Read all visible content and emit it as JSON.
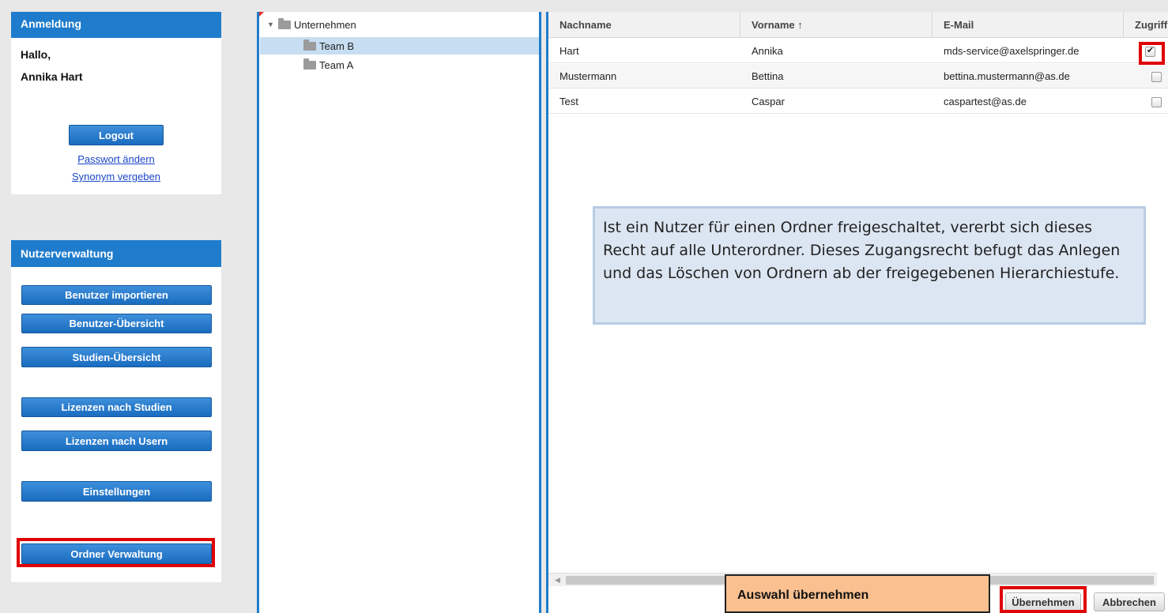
{
  "login_panel": {
    "title": "Anmeldung",
    "greeting": "Hallo,",
    "user_name": "Annika Hart",
    "logout_label": "Logout",
    "change_password_label": "Passwort ändern",
    "assign_synonym_label": "Synonym vergeben"
  },
  "user_admin_panel": {
    "title": "Nutzerverwaltung",
    "buttons": [
      "Benutzer importieren",
      "Benutzer-Übersicht",
      "Studien-Übersicht",
      "Lizenzen nach Studien",
      "Lizenzen nach Usern",
      "Einstellungen",
      "Ordner Verwaltung"
    ]
  },
  "tree": {
    "root": "Unternehmen",
    "children": [
      "Team B",
      "Team A"
    ],
    "selected": "Team B"
  },
  "grid": {
    "columns": [
      "Nachname",
      "Vorname ↑",
      "E-Mail",
      "Zugriff"
    ],
    "rows": [
      {
        "nachname": "Hart",
        "vorname": "Annika",
        "email": "mds-service@axelspringer.de",
        "zugriff": true
      },
      {
        "nachname": "Mustermann",
        "vorname": "Bettina",
        "email": "bettina.mustermann@as.de",
        "zugriff": false
      },
      {
        "nachname": "Test",
        "vorname": "Caspar",
        "email": "caspartest@as.de",
        "zugriff": false
      }
    ]
  },
  "callout_text": "Ist ein Nutzer für einen Ordner freigeschaltet, vererbt sich dieses Recht auf alle Unterordner. Dieses Zugangsrecht befugt das Anlegen und das Löschen von Ordnern ab der freigegebenen Hierarchiestufe.",
  "annotation_label": "Auswahl übernehmen",
  "footer": {
    "apply_label": "Übernehmen",
    "cancel_label": "Abbrechen"
  },
  "colors": {
    "accent": "#1f7ccc",
    "highlight": "#e00000",
    "callout_bg": "#dce6f2",
    "annotation_bg": "#fac090"
  },
  "icons": [
    "folder-icon",
    "expand-triangle-icon",
    "sort-ascending-icon",
    "checkbox-icon"
  ]
}
